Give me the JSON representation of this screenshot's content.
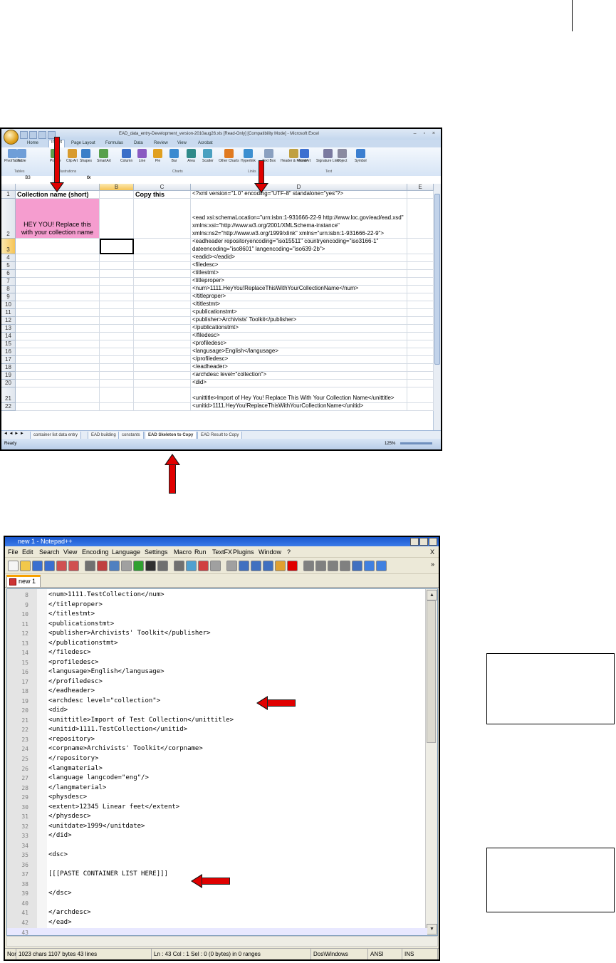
{
  "excel": {
    "window_title": "EAD_data_entry-Development_version-2010aug26.xls [Read-Only] [Compatibility Mode] - Microsoft Excel",
    "tabs": [
      "Home",
      "Insert",
      "Page Layout",
      "Formulas",
      "Data",
      "Review",
      "View",
      "Acrobat"
    ],
    "active_tab": "Insert",
    "ribbon_buttons": [
      "PivotTable",
      "Table",
      "Picture",
      "Clip Art",
      "Shapes",
      "SmartArt",
      "Column",
      "Line",
      "Pie",
      "Bar",
      "Area",
      "Scatter",
      "Other Charts",
      "Hyperlink",
      "Text Box",
      "Header & Footer",
      "WordArt",
      "Signature Line",
      "Object",
      "Symbol"
    ],
    "ribbon_groups": [
      "Tables",
      "Illustrations",
      "Charts",
      "Links",
      "Text"
    ],
    "name_box": "B3",
    "fx_label": "fx",
    "columns": [
      "A",
      "B",
      "C",
      "D",
      "E"
    ],
    "rows": [
      {
        "num": "1",
        "a": "Collection name (short)",
        "c": "Copy this column>",
        "d": "<?xml version=\"1.0\" encoding=\"UTF-8\" standalone=\"yes\"?>"
      },
      {
        "num": "2",
        "a": "HEY YOU! Replace this with your collection name",
        "c": "",
        "d": "<ead xsi:schemaLocation=\"urn:isbn:1-931666-22-9 http://www.loc.gov/ead/ead.xsd\" xmlns:xsi=\"http://www.w3.org/2001/XMLSchema-instance\" xmlns:ns2=\"http://www.w3.org/1999/xlink\" xmlns=\"urn:isbn:1-931666-22-9\">"
      },
      {
        "num": "3",
        "a": "",
        "c": "",
        "d": "<eadheader repositoryencoding=\"iso15511\" countryencoding=\"iso3166-1\" dateencoding=\"iso8601\" langencoding=\"iso639-2b\">"
      },
      {
        "num": "4",
        "a": "",
        "c": "",
        "d": "<eadid></eadid>"
      },
      {
        "num": "5",
        "a": "",
        "c": "",
        "d": "<filedesc>"
      },
      {
        "num": "6",
        "a": "",
        "c": "",
        "d": "<titlestmt>"
      },
      {
        "num": "7",
        "a": "",
        "c": "",
        "d": "<titleproper>"
      },
      {
        "num": "8",
        "a": "",
        "c": "",
        "d": "<num>1111.HeyYou!ReplaceThisWithYourCollectionName</num>"
      },
      {
        "num": "9",
        "a": "",
        "c": "",
        "d": "</titleproper>"
      },
      {
        "num": "10",
        "a": "",
        "c": "",
        "d": "</titlestmt>"
      },
      {
        "num": "11",
        "a": "",
        "c": "",
        "d": "<publicationstmt>"
      },
      {
        "num": "12",
        "a": "",
        "c": "",
        "d": "<publisher>Archivists' Toolkit</publisher>"
      },
      {
        "num": "13",
        "a": "",
        "c": "",
        "d": "</publicationstmt>"
      },
      {
        "num": "14",
        "a": "",
        "c": "",
        "d": "</filedesc>"
      },
      {
        "num": "15",
        "a": "",
        "c": "",
        "d": "<profiledesc>"
      },
      {
        "num": "16",
        "a": "",
        "c": "",
        "d": "<langusage>English</langusage>"
      },
      {
        "num": "17",
        "a": "",
        "c": "",
        "d": "</profiledesc>"
      },
      {
        "num": "18",
        "a": "",
        "c": "",
        "d": "</eadheader>"
      },
      {
        "num": "19",
        "a": "",
        "c": "",
        "d": "<archdesc level=\"collection\">"
      },
      {
        "num": "20",
        "a": "",
        "c": "",
        "d": "<did>"
      },
      {
        "num": "21",
        "a": "",
        "c": "",
        "d": "<unittitle>Import of Hey You! Replace This With Your Collection Name</unittitle>"
      },
      {
        "num": "22",
        "a": "",
        "c": "",
        "d": "<unitid>1111.HeyYou!ReplaceThisWithYourCollectionName</unitid>"
      }
    ],
    "sheet_tabs": [
      "container list data entry",
      "EAD building",
      "constants",
      "EAD Skeleton to Copy",
      "EAD Result to Copy"
    ],
    "active_sheet": "EAD Skeleton to Copy",
    "status_ready": "Ready",
    "zoom": "125%"
  },
  "notepad": {
    "window_title": "new 1 - Notepad++",
    "menu": [
      "File",
      "Edit",
      "Search",
      "View",
      "Encoding",
      "Language",
      "Settings",
      "Macro",
      "Run",
      "TextFX",
      "Plugins",
      "Window",
      "?"
    ],
    "close_x": "X",
    "tab_label": "new 1",
    "lines": [
      {
        "n": "8",
        "code": "<num>1111.TestCollection</num>"
      },
      {
        "n": "9",
        "code": "</titleproper>"
      },
      {
        "n": "10",
        "code": "</titlestmt>"
      },
      {
        "n": "11",
        "code": "<publicationstmt>"
      },
      {
        "n": "12",
        "code": "<publisher>Archivists' Toolkit</publisher>"
      },
      {
        "n": "13",
        "code": "</publicationstmt>"
      },
      {
        "n": "14",
        "code": "</filedesc>"
      },
      {
        "n": "15",
        "code": "<profiledesc>"
      },
      {
        "n": "16",
        "code": "<langusage>English</langusage>"
      },
      {
        "n": "17",
        "code": "</profiledesc>"
      },
      {
        "n": "18",
        "code": "</eadheader>"
      },
      {
        "n": "19",
        "code": "<archdesc level=\"collection\">"
      },
      {
        "n": "20",
        "code": "<did>"
      },
      {
        "n": "21",
        "code": "<unittitle>Import of Test Collection</unittitle>"
      },
      {
        "n": "22",
        "code": "<unitid>1111.TestCollection</unitid>"
      },
      {
        "n": "23",
        "code": "<repository>"
      },
      {
        "n": "24",
        "code": "<corpname>Archivists' Toolkit</corpname>"
      },
      {
        "n": "25",
        "code": "</repository>"
      },
      {
        "n": "26",
        "code": "<langmaterial>"
      },
      {
        "n": "27",
        "code": "<language langcode=\"eng\"/>"
      },
      {
        "n": "28",
        "code": "</langmaterial>"
      },
      {
        "n": "29",
        "code": "<physdesc>"
      },
      {
        "n": "30",
        "code": "<extent>12345 Linear feet</extent>"
      },
      {
        "n": "31",
        "code": "</physdesc>"
      },
      {
        "n": "32",
        "code": "<unitdate>1999</unitdate>"
      },
      {
        "n": "33",
        "code": "</did>"
      },
      {
        "n": "34",
        "code": ""
      },
      {
        "n": "35",
        "code": "<dsc>"
      },
      {
        "n": "36",
        "code": ""
      },
      {
        "n": "37",
        "code": "[[[PASTE CONTAINER LIST HERE]]]"
      },
      {
        "n": "38",
        "code": ""
      },
      {
        "n": "39",
        "code": "</dsc>"
      },
      {
        "n": "40",
        "code": ""
      },
      {
        "n": "41",
        "code": "</archdesc>"
      },
      {
        "n": "42",
        "code": "</ead>"
      },
      {
        "n": "43",
        "code": ""
      }
    ],
    "status": [
      "Nor",
      "1023 chars   1107 bytes   43 lines",
      "Ln : 43    Col : 1    Sel : 0 (0 bytes) in 0 ranges",
      "Dos\\Windows",
      "ANSI",
      "INS"
    ]
  },
  "colors": {
    "arrow": "#e00000",
    "pink_cell": "#f59dcf",
    "npp_title": "#1a58d0",
    "tab_accent": "#f7a100"
  }
}
